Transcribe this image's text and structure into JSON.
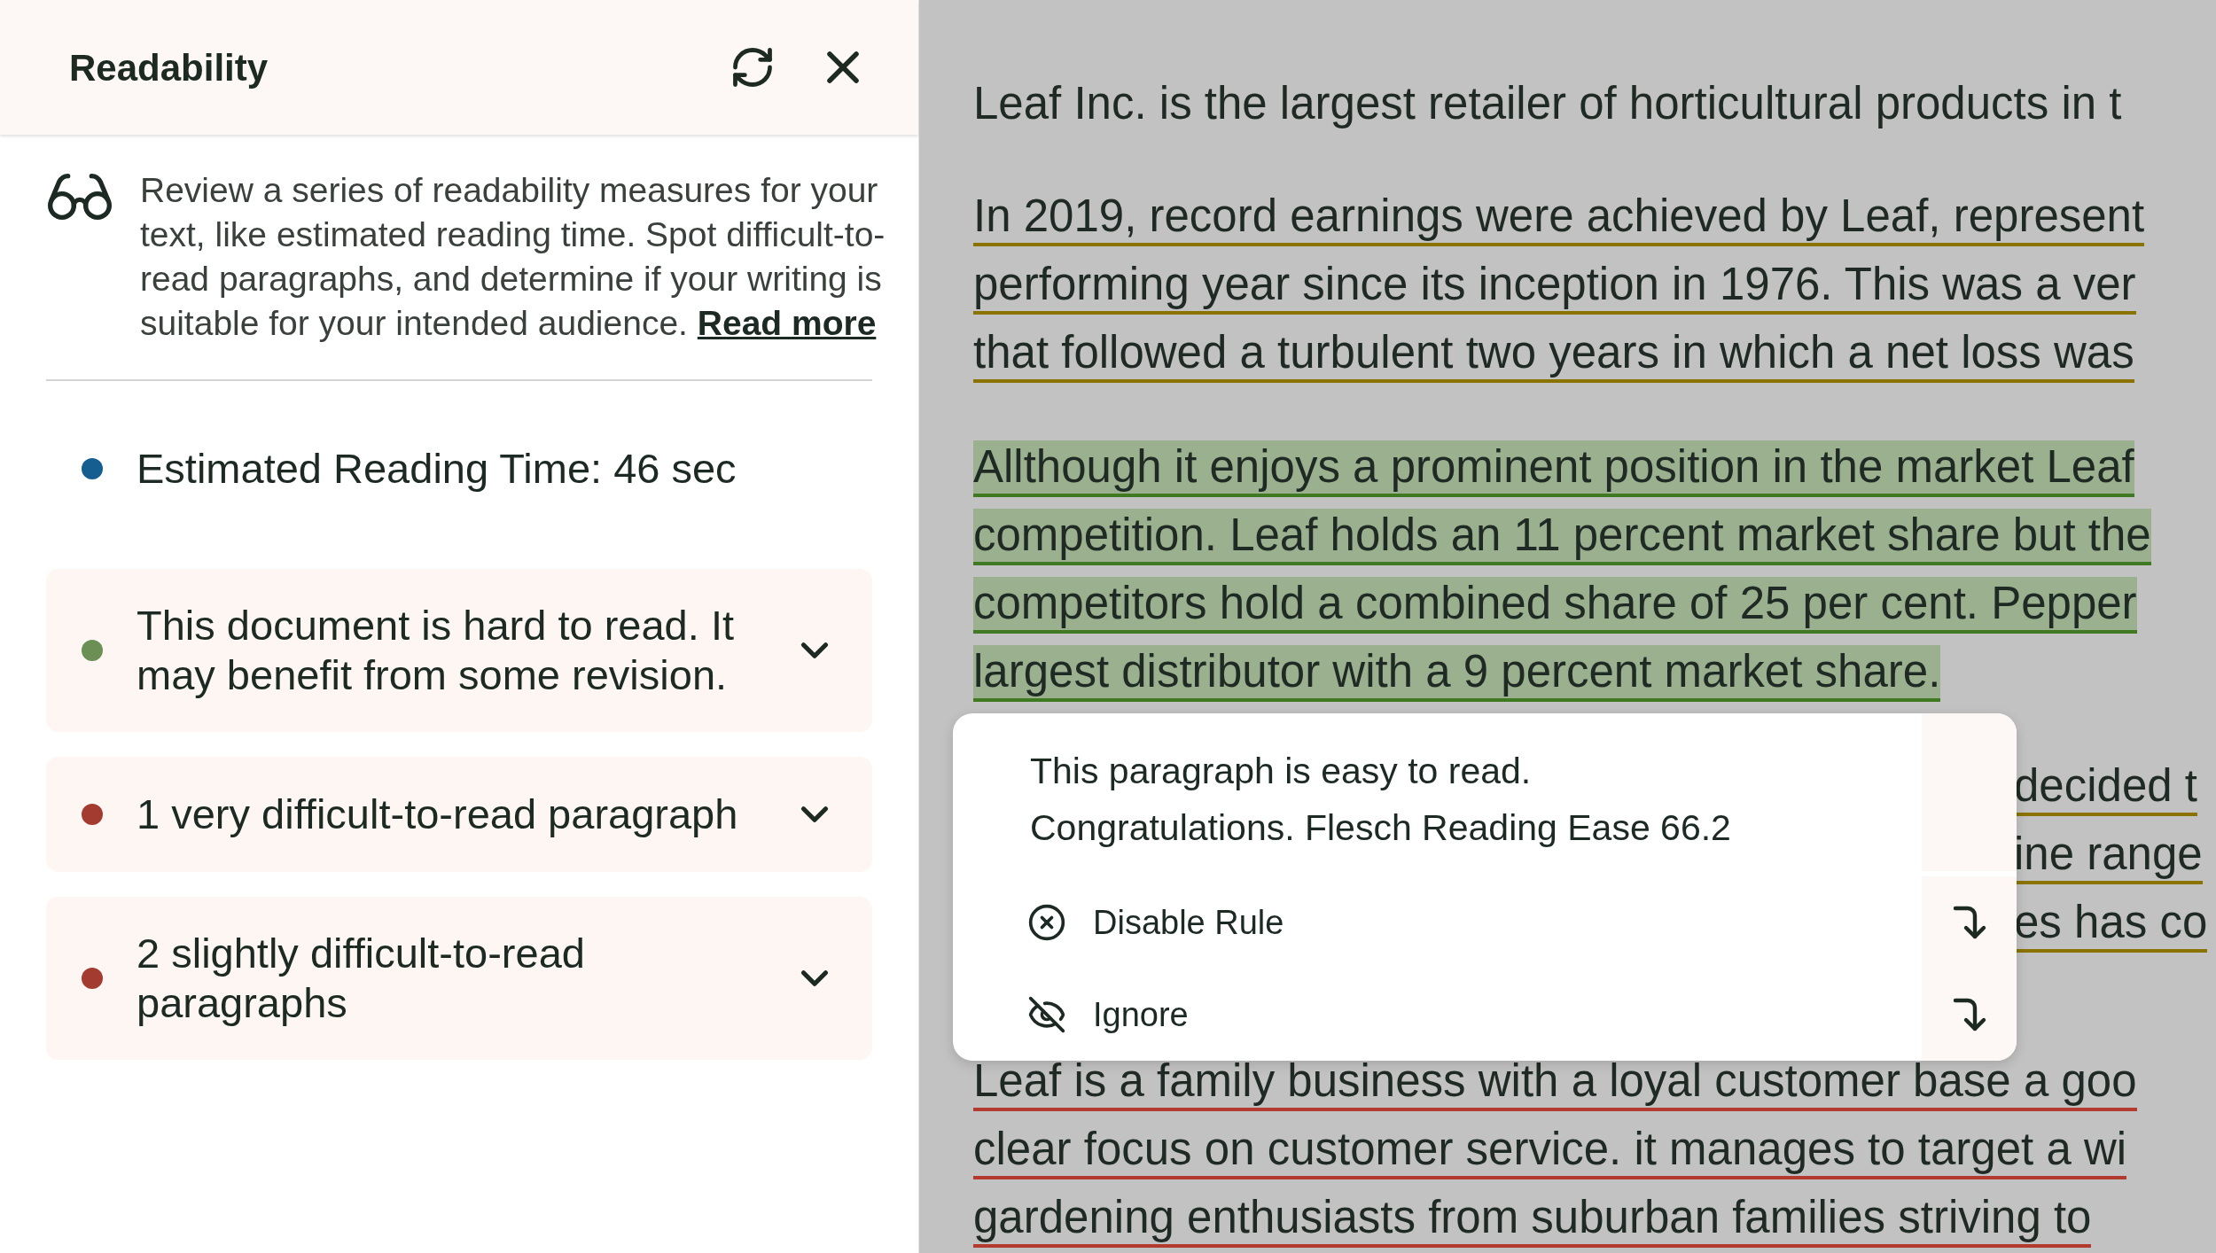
{
  "panel": {
    "title": "Readability",
    "description": "Review a series of readability measures for your text, like estimated reading time. Spot difficult-to-read paragraphs, and determine if your writing is suitable for your intended audience.",
    "read_more": "Read more",
    "items": [
      {
        "kind": "plain",
        "text": "Estimated Reading Time: 46 sec",
        "color": "#155e8f"
      },
      {
        "kind": "expandable",
        "text": "This document is hard to read. It may benefit from some revision.",
        "color": "#6b8f55",
        "expanded": false
      },
      {
        "kind": "expandable",
        "text": "1 very difficult-to-read paragraph",
        "color": "#a33b30",
        "expanded": false
      },
      {
        "kind": "expandable",
        "text": "2 slightly difficult-to-read paragraphs",
        "color": "#a33b30",
        "expanded": false
      }
    ]
  },
  "document": {
    "paragraphs": [
      {
        "kind": "plain",
        "lines": [
          "Leaf Inc. is the largest retailer of horticultural products in t"
        ]
      },
      {
        "kind": "underlined",
        "color": "#8a7300",
        "highlighted": false,
        "lines": [
          "In 2019, record earnings were achieved by Leaf, represent",
          "performing year since its inception in 1976. This was a ver",
          "that followed a turbulent two years in which a net loss was"
        ]
      },
      {
        "kind": "underlined",
        "color": "#3f7a22",
        "highlighted": true,
        "lines": [
          "Allthough it enjoys a prominent position in the market Leaf",
          "competition. Leaf holds an 11 percent market share but the",
          "competitors hold a combined share of 25 per cent. Pepper",
          "largest distributor with a 9 percent market share."
        ]
      },
      {
        "kind": "covered",
        "color": "#8a7300",
        "highlighted": false,
        "lines": [
          "decided t",
          "ine range",
          "es has co"
        ]
      },
      {
        "kind": "underlined",
        "color": "#b33a2e",
        "highlighted": false,
        "lines": [
          "Leaf is a family business with a loyal customer base a goo",
          "clear focus on customer service. it manages to target a wi",
          "gardening enthusiasts from suburban families striving to"
        ]
      }
    ]
  },
  "popup": {
    "message_lines": [
      "This paragraph is easy to read.",
      "Congratulations. Flesch Reading Ease 66.2"
    ],
    "actions": [
      {
        "kind": "disable",
        "label": "Disable Rule"
      },
      {
        "kind": "ignore",
        "label": "Ignore"
      }
    ]
  }
}
